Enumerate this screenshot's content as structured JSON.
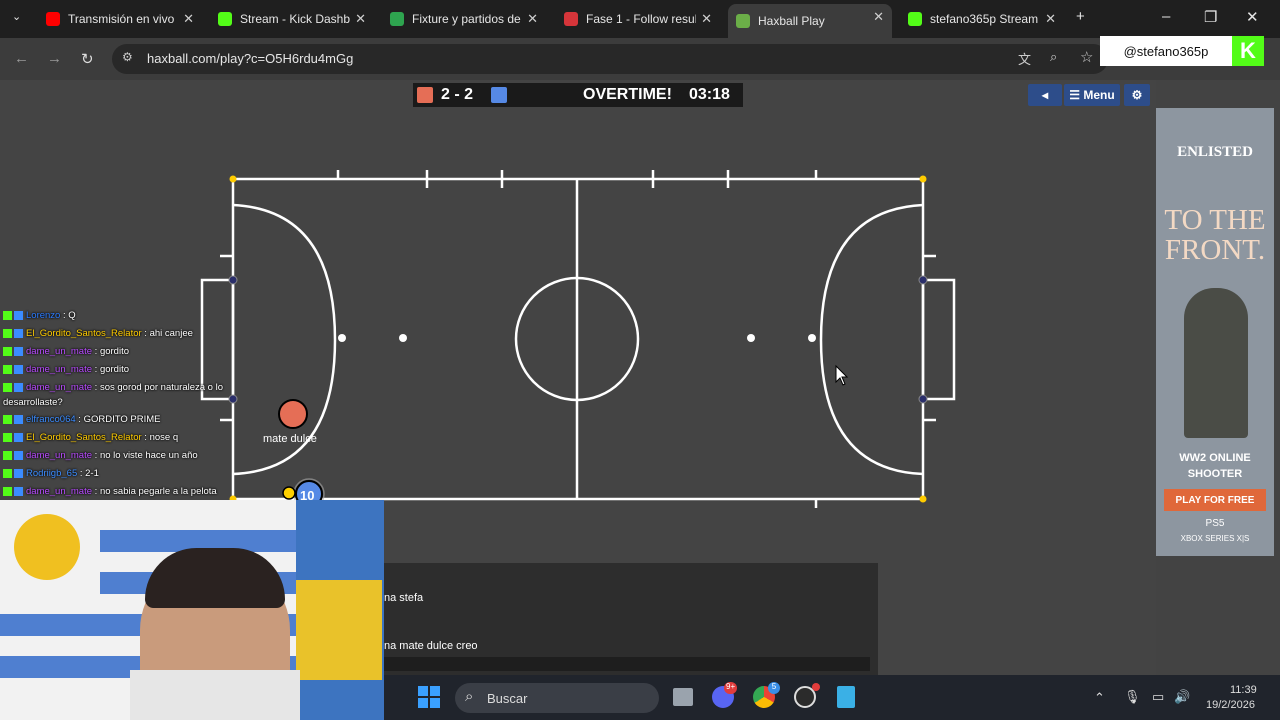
{
  "browser": {
    "tabs": [
      {
        "title": "Transmisión en vivo -",
        "color": "#ff0000"
      },
      {
        "title": "Stream - Kick Dashbo",
        "color": "#53fc18"
      },
      {
        "title": "Fixture y partidos de",
        "color": "#2ea44f"
      },
      {
        "title": "Fase 1 - Follow result",
        "color": "#d6353a"
      },
      {
        "title": "Haxball Play",
        "color": "#6bae48"
      },
      {
        "title": "stefano365p Stream -",
        "color": "#53fc18"
      }
    ],
    "url": "haxball.com/play?c=O5H6rdu4mGg"
  },
  "stream": {
    "handle": "@stefano365p",
    "logo": "K"
  },
  "scoreboard": {
    "score": "2 - 2",
    "status": "OVERTIME!",
    "time": "03:18",
    "red": "#e56e56",
    "blue": "#5689e5"
  },
  "game_controls": {
    "menu_label": "Menu",
    "back_icon": "triangle-left-icon",
    "settings_icon": "gear-icon"
  },
  "players": [
    {
      "name": "mate dulce",
      "avatar": ""
    },
    {
      "name": "",
      "avatar": "10"
    }
  ],
  "chat": [
    {
      "user": "Lorenzo",
      "msg": ": Q",
      "color": "#2b7bff"
    },
    {
      "user": "El_Gordito_Santos_Relator",
      "msg": ": ahi canjee",
      "color": "#ffcc00"
    },
    {
      "user": "dame_un_mate",
      "msg": ": gordito",
      "color": "#b94cff"
    },
    {
      "user": "dame_un_mate",
      "msg": ": gordito",
      "color": "#b94cff"
    },
    {
      "user": "dame_un_mate",
      "msg": ": sos gorod por naturaleza o lo",
      "color": "#b94cff",
      "cont": "desarrollaste?"
    },
    {
      "user": "elfranco064",
      "msg": ": GORDITO PRIME",
      "color": "#3b8cff"
    },
    {
      "user": "El_Gordito_Santos_Relator",
      "msg": ": nose q",
      "color": "#ffcc00"
    },
    {
      "user": "dame_un_mate",
      "msg": ": no lo viste hace un año",
      "color": "#b94cff"
    },
    {
      "user": "Rodriigb_65",
      "msg": ": 2-1",
      "color": "#3b8cff"
    },
    {
      "user": "dame_un_mate",
      "msg": ": no sabia pegarle a la pelota",
      "color": "#b94cff"
    }
  ],
  "game_chat": [
    "na stefa",
    "na mate dulce creo"
  ],
  "ad": {
    "brand": "ENLISTED",
    "headline1": "TO THE",
    "headline2": "FRONT.",
    "sub1": "WW2 ONLINE",
    "sub2": "SHOOTER",
    "cta": "PLAY FOR FREE",
    "platform1": "PS5",
    "platform2": "XBOX SERIES X|S"
  },
  "taskbar": {
    "search": "Buscar",
    "time": "11:39",
    "date": "19/2/2026",
    "discord_badge": "9+",
    "chrome_badge": "5"
  }
}
